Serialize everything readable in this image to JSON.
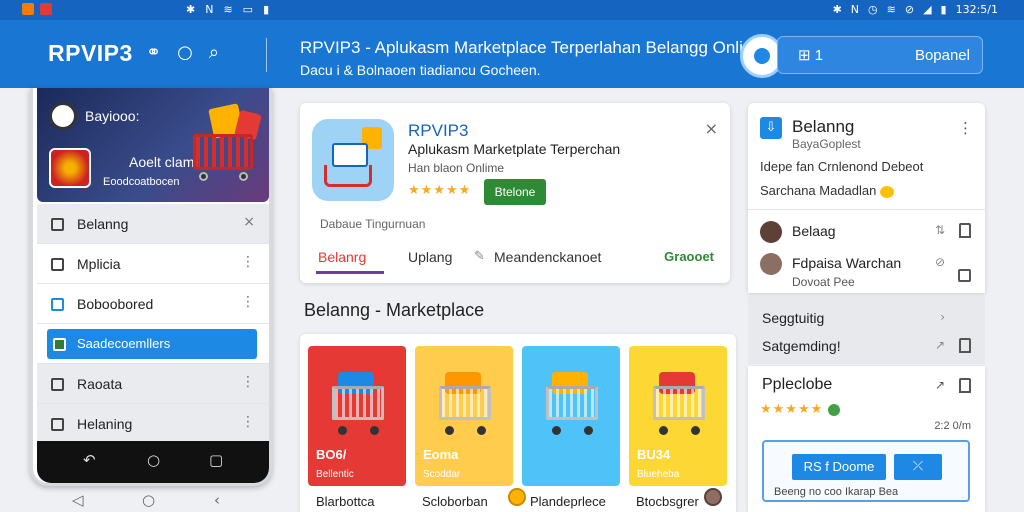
{
  "status_bar": {
    "left_icons": [
      "app-icon-orange",
      "app-icon-red"
    ],
    "mid_icons": [
      "bluetooth-icon",
      "nfc-icon",
      "wifi-icon",
      "sim-icon",
      "battery-icon"
    ],
    "right_icons": [
      "bluetooth-icon",
      "nfc-icon",
      "alarm-icon",
      "wifi-icon",
      "mute-icon",
      "signal-icon",
      "battery-icon"
    ],
    "time": "132:5/1"
  },
  "header": {
    "brand": "RPVIP3",
    "title": "RPVIP3 - Aplukasm Marketplace Terperlahan Belangg Online",
    "subtitle": "Dacu i & Bolnaoen tiadiancu Gocheen.",
    "panel_count": "1",
    "panel_button": "Bopanel",
    "icons": [
      "share-icon",
      "search-icon",
      "zoom-icon"
    ]
  },
  "phone": {
    "promo": {
      "title": "Bayiooo:",
      "label": "Aoelt clam",
      "sub": "Eoodcoatbocen"
    },
    "list": [
      {
        "label": "Belanng",
        "meta": "×",
        "style": "grey"
      },
      {
        "label": "Mplicia",
        "meta": "⋮",
        "style": ""
      },
      {
        "label": "Boboobored",
        "meta": "⋮",
        "style": ""
      },
      {
        "label": "Saadecoemllers",
        "meta": "",
        "style": "active"
      },
      {
        "label": "Raoata",
        "meta": "⋮",
        "style": "grey"
      },
      {
        "label": "Helaning",
        "meta": "⋮",
        "style": "grey"
      }
    ],
    "nav": [
      "↶",
      "○",
      "▢"
    ],
    "system_nav": [
      "◁",
      "○",
      "‹"
    ]
  },
  "app_card": {
    "name": "RPVIP3",
    "tagline": "Aplukasm Marketplate Terperchan",
    "sub": "Han blaon Onlime",
    "stars": "★★★★★",
    "install": "Btelone",
    "close": "×",
    "developer": "Dabaue Tingurnuan",
    "tabs": [
      "Belanrg",
      "Uplang",
      "Meandenckanoet"
    ],
    "tab_action": "Graooet"
  },
  "section": {
    "title": "Belanng - Marketplace"
  },
  "tiles": [
    {
      "price": "BO6/",
      "chip": "Bellentic",
      "bg": "#e53935",
      "goods": "#1e88e5",
      "label": "Blarbottca"
    },
    {
      "price": "Eoma",
      "chip": "Scoddar",
      "bg": "#ffcc4d",
      "goods": "#ff9800",
      "label": "Scloborban"
    },
    {
      "price": "",
      "chip": "",
      "bg": "#4fc3f7",
      "goods": "#ffb300",
      "label": "Plandeprlece"
    },
    {
      "price": "BU34",
      "chip": "Blueheba",
      "bg": "#fdd835",
      "goods": "#e53935",
      "label": "Btocbsgrer"
    }
  ],
  "right_card": {
    "title": "Belanng",
    "sub": "BayaGoplest",
    "desc1": "Idepe fan Crnlenond Debeot",
    "desc2": "Sarchana Madadlan",
    "items": [
      {
        "label": "Belaag",
        "meta": "⇅",
        "avatar": "#5d4037"
      },
      {
        "label": "Fdpaisa Warchan",
        "sub": "Dovoat Pee",
        "meta": "⊘",
        "avatar": "#8d6e63"
      }
    ]
  },
  "right_grey": {
    "items": [
      {
        "label": "Seggtuitig",
        "meta": "›"
      },
      {
        "label": "Satgemding!",
        "meta": "↗"
      }
    ]
  },
  "right_card3": {
    "title": "Ppleclobe",
    "stars": "★★★★★",
    "meta": "↗",
    "time": "2:2 0/m",
    "btn1": "RS f Doome",
    "btn2": "⤫",
    "footer": "Beeng no coo Ikarap Bea"
  }
}
